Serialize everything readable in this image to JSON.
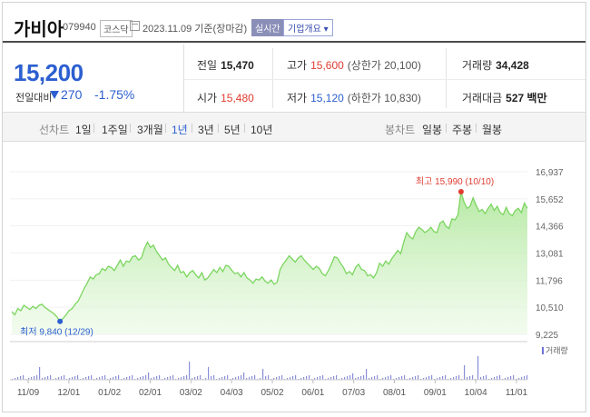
{
  "header": {
    "name": "가비아",
    "code": "079940",
    "market": "코스닥",
    "date": "2023.11.09 기준(장마감)",
    "realtime": "실시간",
    "corp_info": "기업개요 ▾"
  },
  "price": {
    "current": "15,200",
    "change_label": "전일대비",
    "change": "270",
    "change_pct": "-1.75%",
    "direction": "down",
    "color_down": "#2c5fd0",
    "color_up": "#e03c31"
  },
  "info": {
    "prev_label": "전일",
    "prev": "15,470",
    "high_label": "고가",
    "high": "15,600",
    "upper_limit": "(상한가 20,100)",
    "volume_label": "거래량",
    "volume": "34,428",
    "open_label": "시가",
    "open": "15,480",
    "low_label": "저가",
    "low": "15,120",
    "lower_limit": "(하한가 10,830)",
    "amount_label": "거래대금",
    "amount": "527 백만"
  },
  "toolbar": {
    "line_label": "선차트",
    "periods": [
      "1일",
      "1주일",
      "3개월",
      "1년",
      "3년",
      "5년",
      "10년"
    ],
    "selected_period": "1년",
    "candle_label": "봉차트",
    "candles": [
      "일봉",
      "주봉",
      "월봉"
    ]
  },
  "chart_data": {
    "type": "area",
    "y_ticks": [
      "16,937",
      "15,652",
      "14,366",
      "13,081",
      "11,796",
      "10,510",
      "9,225"
    ],
    "ylim": [
      9225,
      16937
    ],
    "x_ticks": [
      "11/09",
      "12/01",
      "01/02",
      "02/01",
      "03/02",
      "04/03",
      "05/02",
      "06/01",
      "07/03",
      "08/01",
      "09/01",
      "10/04",
      "11/01"
    ],
    "high_label": "최고 15,990 (10/10)",
    "low_label": "최저 9,840 (12/29)",
    "volume_label": "거래량",
    "series": [
      {
        "values": [
          10300,
          10150,
          10450,
          10350,
          10600,
          10500,
          10400,
          10550,
          10450,
          10600,
          10650,
          10500,
          10400,
          10300,
          10200,
          10050,
          9840,
          9980,
          10150,
          10350,
          10450,
          10650,
          10800,
          11100,
          11400,
          11650,
          11950,
          11850,
          12050,
          12100,
          12350,
          12250,
          12450,
          12400,
          12250,
          12500,
          12750,
          12450,
          12700,
          12650,
          12900,
          12950,
          12750,
          12850,
          13300,
          13600,
          13350,
          13450,
          13150,
          12950,
          12750,
          12850,
          12550,
          12400,
          12250,
          12500,
          12150,
          12200,
          11950,
          12150,
          12250,
          12050,
          11900,
          12150,
          11800,
          11900,
          12100,
          12300,
          12150,
          12400,
          12200,
          12500,
          12450,
          12250,
          12100,
          12150,
          11950,
          12150,
          11900,
          11800,
          11650,
          11850,
          11800,
          11950,
          11750,
          11650,
          11800,
          11600,
          11700,
          12300,
          12550,
          12750,
          12950,
          12800,
          12650,
          12850,
          12950,
          12750,
          12600,
          12450,
          12300,
          12450,
          12350,
          12100,
          12000,
          12250,
          12550,
          12900,
          12850,
          12600,
          12400,
          12100,
          12200,
          12050,
          12400,
          12550,
          12300,
          12250,
          12000,
          12050,
          11900,
          12150,
          12600,
          12450,
          12700,
          12550,
          12800,
          13000,
          13200,
          13050,
          13600,
          14050,
          13850,
          13750,
          14100,
          14300,
          14200,
          14050,
          14150,
          14300,
          14100,
          14050,
          14500,
          14600,
          14350,
          14250,
          14700,
          14650,
          14900,
          15990,
          15500,
          15200,
          15300,
          15700,
          15350,
          15050,
          15150,
          14950,
          15200,
          15400,
          15100,
          15300,
          15000,
          14900,
          15250,
          14950,
          14850,
          15100,
          15200,
          15000,
          15450,
          15200
        ]
      }
    ]
  }
}
